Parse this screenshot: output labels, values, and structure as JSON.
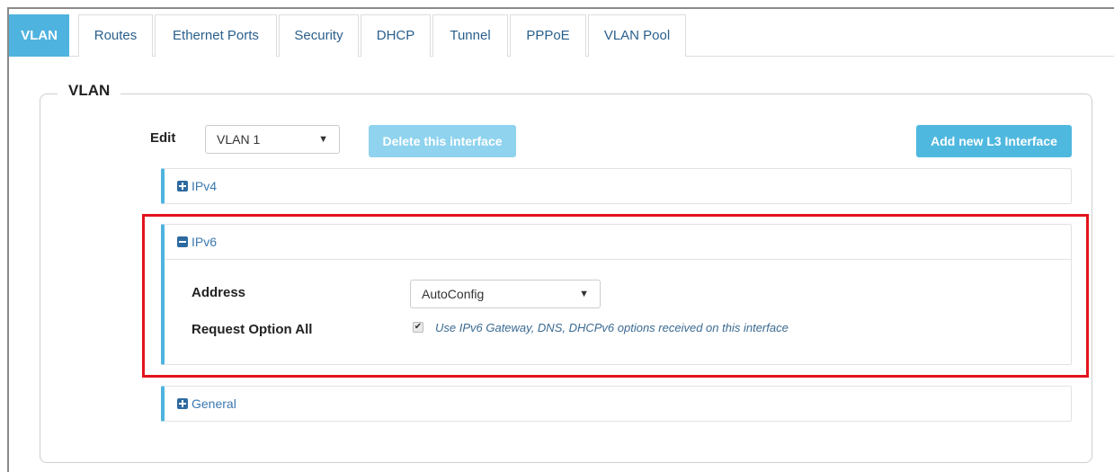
{
  "tabs": [
    {
      "label": "VLAN",
      "active": true
    },
    {
      "label": "Routes",
      "active": false
    },
    {
      "label": "Ethernet Ports",
      "active": false
    },
    {
      "label": "Security",
      "active": false
    },
    {
      "label": "DHCP",
      "active": false
    },
    {
      "label": "Tunnel",
      "active": false
    },
    {
      "label": "PPPoE",
      "active": false
    },
    {
      "label": "VLAN Pool",
      "active": false
    }
  ],
  "section": {
    "legend": "VLAN"
  },
  "edit": {
    "label": "Edit",
    "selected": "VLAN 1",
    "arrow": "▼"
  },
  "buttons": {
    "delete_label": "Delete this interface",
    "add_label": "Add new L3 Interface"
  },
  "panels": {
    "ipv4": {
      "label": "IPv4",
      "icon": "plus-square-icon",
      "expanded": false
    },
    "ipv6": {
      "label": "IPv6",
      "icon": "minus-square-icon",
      "expanded": true,
      "address_label": "Address",
      "address_value": "AutoConfig",
      "request_label": "Request Option All",
      "request_checked": true,
      "request_text": "Use IPv6 Gateway, DNS, DHCPv6 options received on this interface"
    },
    "general": {
      "label": "General",
      "icon": "plus-square-icon",
      "expanded": false
    }
  },
  "colors": {
    "accent": "#4fb3df",
    "highlight": "#e3141c",
    "link": "#3a78b0"
  }
}
